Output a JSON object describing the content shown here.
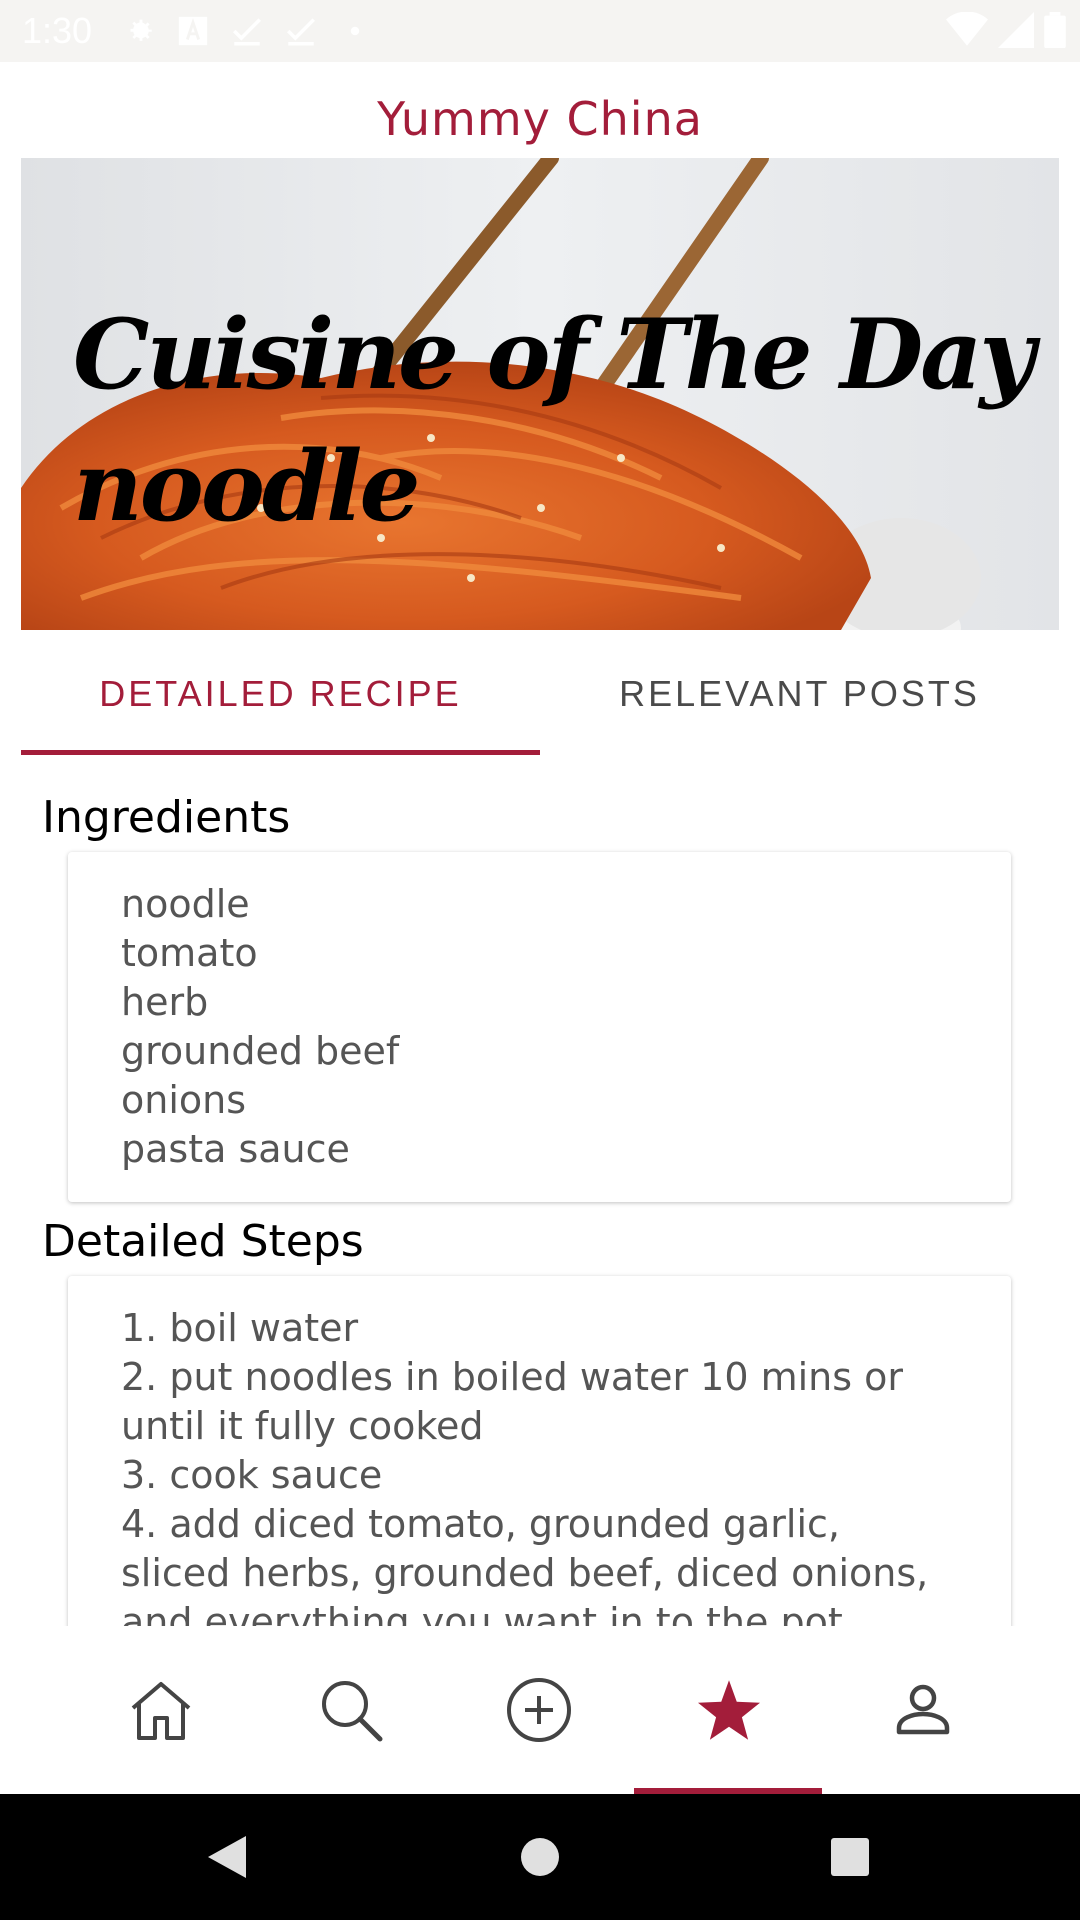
{
  "status_bar": {
    "time": "1:30",
    "icons_left": [
      "settings-icon",
      "text-a-icon",
      "check-icon",
      "check-icon",
      "dot-icon"
    ],
    "icons_right": [
      "wifi-icon",
      "signal-icon",
      "battery-icon"
    ]
  },
  "app_bar": {
    "title": "Yummy China"
  },
  "hero": {
    "line1": "Cuisine of The Day",
    "line2": "noodle",
    "image": "noodles-bowl-with-chopsticks"
  },
  "tabs": [
    {
      "label": "DETAILED RECIPE",
      "selected": true
    },
    {
      "label": "RELEVANT POSTS",
      "selected": false
    }
  ],
  "ingredients": {
    "heading": "Ingredients",
    "items": [
      "noodle",
      "tomato",
      "herb",
      "grounded beef",
      "onions",
      "pasta sauce"
    ]
  },
  "steps": {
    "heading": "Detailed Steps",
    "lines": [
      "1. boil water",
      "2. put noodles in boiled water 10 mins or",
      "until it fully cooked",
      "3. cook sauce",
      "4. add diced tomato, grounded garlic,",
      "sliced herbs, grounded beef, diced onions,",
      "and everything you want in to the pot"
    ]
  },
  "bottom_nav": {
    "items": [
      "home-icon",
      "search-icon",
      "add-circle-icon",
      "star-icon",
      "person-icon"
    ],
    "selected_index": 3
  },
  "colors": {
    "accent": "#a31d3a",
    "tab_inactive": "#4a4a4a",
    "card_text": "#555555"
  }
}
